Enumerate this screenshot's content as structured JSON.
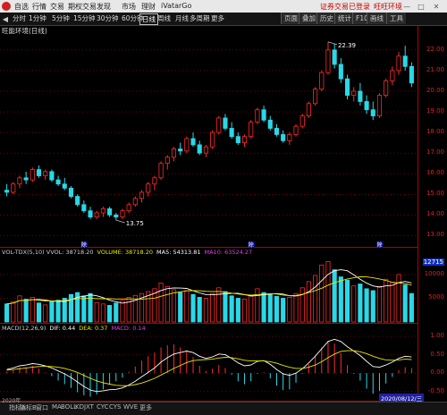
{
  "menu": {
    "items": [
      "自选",
      "行情",
      "交易",
      "期权交易",
      "发现",
      "市场",
      "理财",
      "iVatarGo"
    ],
    "right_links": [
      "证券交易已登录",
      "旺旺环境"
    ]
  },
  "toolbar": {
    "periods": [
      "分时",
      "1分钟",
      "5分钟",
      "15分钟",
      "30分钟",
      "60分钟",
      "日线",
      "周线",
      "月线",
      "多周期",
      "更多"
    ],
    "selected": "日线",
    "right_buttons": [
      "页面",
      "叠加",
      "历史",
      "统计",
      "F10",
      "画线",
      "工具"
    ]
  },
  "main": {
    "title": "旺能环境(日线)",
    "price_ticks": [
      "22.00",
      "21.00",
      "20.00",
      "19.00",
      "18.00",
      "17.00",
      "16.00",
      "15.00",
      "14.00",
      "13.00"
    ],
    "high_label": "22.39",
    "low_label": "13.75",
    "markers": [
      "除",
      "除",
      "除"
    ]
  },
  "volume": {
    "legend": [
      {
        "text": "VOL-TDX(5,10)  VVOL: 38718.20",
        "color": "#cfcfcf"
      },
      {
        "text": "VOLUME: 38718.20",
        "color": "#e8e800"
      },
      {
        "text": "MA5: 54313.81",
        "color": "#ffffff"
      },
      {
        "text": "MA10: 63524.27",
        "color": "#e040e0"
      }
    ],
    "axis_tick": "12715",
    "ticks": [
      "10000",
      "5000"
    ]
  },
  "macd": {
    "legend": [
      {
        "text": "MACD(12,26,9)",
        "color": "#cfcfcf"
      },
      {
        "text": "DIF: 0.44",
        "color": "#ffffff"
      },
      {
        "text": "DEA: 0.37",
        "color": "#e8e800"
      },
      {
        "text": "MACD: 0.14",
        "color": "#e040e0"
      }
    ],
    "ticks": [
      "1.00",
      "0.50",
      "0.00",
      "-0.50"
    ],
    "date_label": "2020/08/12/三"
  },
  "status": {
    "items": [
      "指标A",
      "指标B",
      "窗口",
      "MA",
      "BOLL",
      "KDJ",
      "XT",
      "CYC",
      "CYS",
      "WVE",
      "更多"
    ],
    "year": "2020年"
  },
  "colors": {
    "up": "#ff2a2a",
    "down": "#29d8e8",
    "grid": "#b00000",
    "background": "#000000"
  },
  "chart_data": {
    "type": "candlestick",
    "series_name": "旺能环境 日线",
    "ylim": [
      12.8,
      22.6
    ],
    "ohlc": [
      [
        15.2,
        15.5,
        14.9,
        15.1
      ],
      [
        15.1,
        15.6,
        15.0,
        15.5
      ],
      [
        15.5,
        15.9,
        15.3,
        15.8
      ],
      [
        15.8,
        16.1,
        15.5,
        15.7
      ],
      [
        15.7,
        16.3,
        15.6,
        16.2
      ],
      [
        16.2,
        16.4,
        15.8,
        15.9
      ],
      [
        15.9,
        16.2,
        15.7,
        16.1
      ],
      [
        16.1,
        16.2,
        15.6,
        15.7
      ],
      [
        15.7,
        15.9,
        15.4,
        15.5
      ],
      [
        15.5,
        15.8,
        15.2,
        15.3
      ],
      [
        15.3,
        15.4,
        14.8,
        14.9
      ],
      [
        14.9,
        15.0,
        14.4,
        14.5
      ],
      [
        14.5,
        14.7,
        14.1,
        14.2
      ],
      [
        14.2,
        14.4,
        13.8,
        13.9
      ],
      [
        13.9,
        14.2,
        13.8,
        14.1
      ],
      [
        14.1,
        14.4,
        13.9,
        14.3
      ],
      [
        14.3,
        14.4,
        13.9,
        14.0
      ],
      [
        14.0,
        14.1,
        13.75,
        13.9
      ],
      [
        13.9,
        14.3,
        13.8,
        14.2
      ],
      [
        14.2,
        14.6,
        14.1,
        14.5
      ],
      [
        14.5,
        14.9,
        14.4,
        14.8
      ],
      [
        14.8,
        15.2,
        14.6,
        15.1
      ],
      [
        15.1,
        15.6,
        14.9,
        15.5
      ],
      [
        15.5,
        15.9,
        15.2,
        15.8
      ],
      [
        15.8,
        16.6,
        15.7,
        16.5
      ],
      [
        16.5,
        16.9,
        16.2,
        16.8
      ],
      [
        16.8,
        17.3,
        16.6,
        17.2
      ],
      [
        17.2,
        17.5,
        16.9,
        17.1
      ],
      [
        17.1,
        17.8,
        17.0,
        17.7
      ],
      [
        17.7,
        18.0,
        17.3,
        17.4
      ],
      [
        17.4,
        17.6,
        16.9,
        17.0
      ],
      [
        17.0,
        17.4,
        16.8,
        17.3
      ],
      [
        17.3,
        18.1,
        17.2,
        18.0
      ],
      [
        18.0,
        18.8,
        17.9,
        18.7
      ],
      [
        18.7,
        18.9,
        18.1,
        18.2
      ],
      [
        18.2,
        18.5,
        17.7,
        17.8
      ],
      [
        17.8,
        18.0,
        17.4,
        17.5
      ],
      [
        17.5,
        17.9,
        17.3,
        17.8
      ],
      [
        17.8,
        18.6,
        17.7,
        18.5
      ],
      [
        18.5,
        19.2,
        18.4,
        19.1
      ],
      [
        19.1,
        19.3,
        18.5,
        18.6
      ],
      [
        18.6,
        18.8,
        18.1,
        18.2
      ],
      [
        18.2,
        18.4,
        17.8,
        17.9
      ],
      [
        17.9,
        18.1,
        17.5,
        17.6
      ],
      [
        17.6,
        18.0,
        17.4,
        17.9
      ],
      [
        17.9,
        18.4,
        17.8,
        18.3
      ],
      [
        18.3,
        18.9,
        18.2,
        18.8
      ],
      [
        18.8,
        19.5,
        18.7,
        19.4
      ],
      [
        19.4,
        20.2,
        19.3,
        20.1
      ],
      [
        20.1,
        21.0,
        20.0,
        20.9
      ],
      [
        20.9,
        22.39,
        20.8,
        22.0
      ],
      [
        22.0,
        22.3,
        21.1,
        21.3
      ],
      [
        21.3,
        21.6,
        20.4,
        20.6
      ],
      [
        20.6,
        20.8,
        19.6,
        19.8
      ],
      [
        19.8,
        20.2,
        19.5,
        20.0
      ],
      [
        20.0,
        20.4,
        19.3,
        19.5
      ],
      [
        19.5,
        19.8,
        18.9,
        19.1
      ],
      [
        19.1,
        19.5,
        18.6,
        18.8
      ],
      [
        18.8,
        19.9,
        18.7,
        19.8
      ],
      [
        19.8,
        20.6,
        19.7,
        20.5
      ],
      [
        20.5,
        21.2,
        20.3,
        21.0
      ],
      [
        21.0,
        21.9,
        20.8,
        21.7
      ],
      [
        21.7,
        22.2,
        21.0,
        21.2
      ],
      [
        21.2,
        21.4,
        20.2,
        20.4
      ]
    ],
    "volume": [
      38,
      42,
      55,
      48,
      52,
      40,
      36,
      44,
      46,
      50,
      58,
      62,
      55,
      60,
      41,
      38,
      35,
      40,
      45,
      52,
      56,
      60,
      64,
      70,
      82,
      75,
      68,
      62,
      66,
      58,
      52,
      50,
      60,
      72,
      64,
      55,
      50,
      48,
      56,
      70,
      62,
      58,
      54,
      50,
      52,
      60,
      72,
      85,
      98,
      120,
      127,
      110,
      95,
      88,
      76,
      80,
      70,
      66,
      75,
      90,
      84,
      100,
      78,
      60
    ],
    "dif": [
      0.1,
      0.14,
      0.2,
      0.22,
      0.26,
      0.24,
      0.2,
      0.14,
      0.06,
      -0.02,
      -0.12,
      -0.24,
      -0.36,
      -0.46,
      -0.5,
      -0.48,
      -0.45,
      -0.44,
      -0.4,
      -0.32,
      -0.22,
      -0.1,
      0.02,
      0.14,
      0.3,
      0.42,
      0.52,
      0.56,
      0.6,
      0.56,
      0.46,
      0.4,
      0.44,
      0.52,
      0.5,
      0.4,
      0.28,
      0.2,
      0.22,
      0.32,
      0.34,
      0.24,
      0.1,
      -0.02,
      -0.06,
      0.0,
      0.12,
      0.28,
      0.46,
      0.66,
      0.86,
      0.92,
      0.86,
      0.72,
      0.6,
      0.48,
      0.32,
      0.18,
      0.16,
      0.22,
      0.3,
      0.4,
      0.46,
      0.44
    ],
    "dea": [
      0.08,
      0.1,
      0.12,
      0.14,
      0.16,
      0.18,
      0.19,
      0.18,
      0.16,
      0.13,
      0.08,
      0.02,
      -0.06,
      -0.14,
      -0.21,
      -0.26,
      -0.3,
      -0.33,
      -0.34,
      -0.34,
      -0.31,
      -0.27,
      -0.21,
      -0.14,
      -0.05,
      0.04,
      0.13,
      0.21,
      0.29,
      0.34,
      0.36,
      0.37,
      0.38,
      0.41,
      0.43,
      0.42,
      0.39,
      0.35,
      0.33,
      0.33,
      0.33,
      0.31,
      0.27,
      0.21,
      0.16,
      0.13,
      0.13,
      0.16,
      0.22,
      0.31,
      0.42,
      0.52,
      0.59,
      0.61,
      0.61,
      0.58,
      0.53,
      0.46,
      0.4,
      0.36,
      0.35,
      0.36,
      0.38,
      0.37
    ]
  }
}
